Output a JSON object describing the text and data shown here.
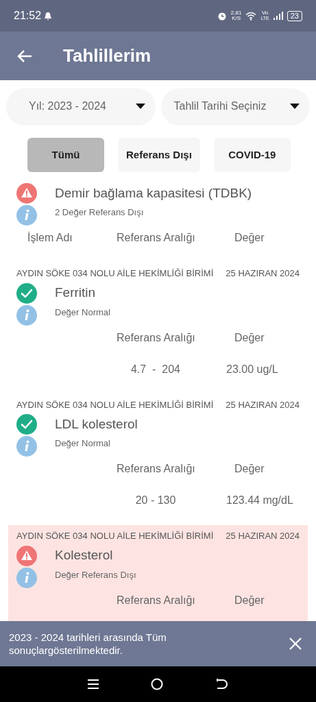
{
  "status_bar": {
    "time": "21:52",
    "speed": "2,81",
    "speed_unit": "K/S",
    "network": "Vo",
    "network_sub": "LTE",
    "battery": "23"
  },
  "app_bar": {
    "title": "Tahlillerim"
  },
  "filters": [
    {
      "label": "Yıl: 2023 - 2024"
    },
    {
      "label": "Tahlil Tarihi Seçiniz"
    }
  ],
  "tabs": [
    {
      "label": "Tümü",
      "selected": true
    },
    {
      "label": "Referans Dışı",
      "selected": false
    },
    {
      "label": "COVID-19",
      "selected": false
    }
  ],
  "results": [
    {
      "kind": "alert",
      "highlighted": false,
      "name": "Demir bağlama kapasitesi (TDBK)",
      "note": "2 Değer Referans Dışı",
      "columns": {
        "name": "İşlem Adı",
        "range": "Referans Aralığı",
        "value": "Değer"
      }
    },
    {
      "kind": "normal",
      "highlighted": false,
      "unit": "AYDIN SÖKE 034 NOLU AİLE HEKİMLİĞİ BİRİMİ",
      "date": "25 HAZIRAN 2024",
      "name": "Ferritin",
      "note": "Değer Normal",
      "columns": {
        "range": "Referans Aralığı",
        "value": "Değer"
      },
      "range": "4.7  -  204",
      "value": "23.00 ug/L"
    },
    {
      "kind": "normal",
      "highlighted": false,
      "unit": "AYDIN SÖKE 034 NOLU AİLE HEKİMLİĞİ BİRİMİ",
      "date": "25 HAZIRAN 2024",
      "name": "LDL kolesterol",
      "note": "Değer Normal",
      "columns": {
        "range": "Referans Aralığı",
        "value": "Değer"
      },
      "range": "20 - 130",
      "value": "123.44 mg/dL"
    },
    {
      "kind": "alert",
      "highlighted": true,
      "unit": "AYDIN SÖKE 034 NOLU AİLE HEKİMLİĞİ BİRİMİ",
      "date": "25 HAZIRAN 2024",
      "name": "Kolesterol",
      "note": "Değer Referans Dışı",
      "columns": {
        "range": "Referans Aralığı",
        "value": "Değer"
      }
    }
  ],
  "snackbar": {
    "message": "2023 - 2024 tarihleri arasında Tüm sonuçlargösterilmektedir."
  }
}
